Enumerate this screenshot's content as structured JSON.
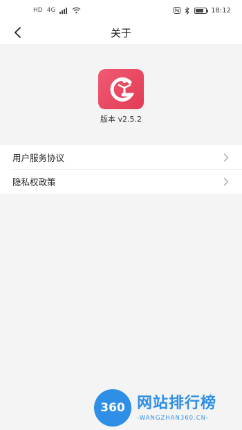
{
  "status_bar": {
    "left_badges": [
      "HD",
      "4G"
    ],
    "right_icons": [
      "nfc-icon",
      "bluetooth-icon",
      "battery-icon"
    ],
    "time": "18:12",
    "battery_level": 0.8
  },
  "nav": {
    "title": "关于",
    "back_icon": "chevron-left-icon"
  },
  "about": {
    "app_icon": "app-logo-icon",
    "version": "版本 v2.5.2"
  },
  "menu": {
    "items": [
      {
        "label": "用户服务协议",
        "icon": "chevron-right-icon"
      },
      {
        "label": "隐私权政策",
        "icon": "chevron-right-icon"
      }
    ]
  },
  "watermark": {
    "logo_text": "360",
    "title": "网站排行榜",
    "subtitle": "-WANGZHAN360.CN-"
  },
  "colors": {
    "accent": "#e23b55",
    "page_bg": "#f4f4f4",
    "watermark": "#2f8fe6"
  }
}
